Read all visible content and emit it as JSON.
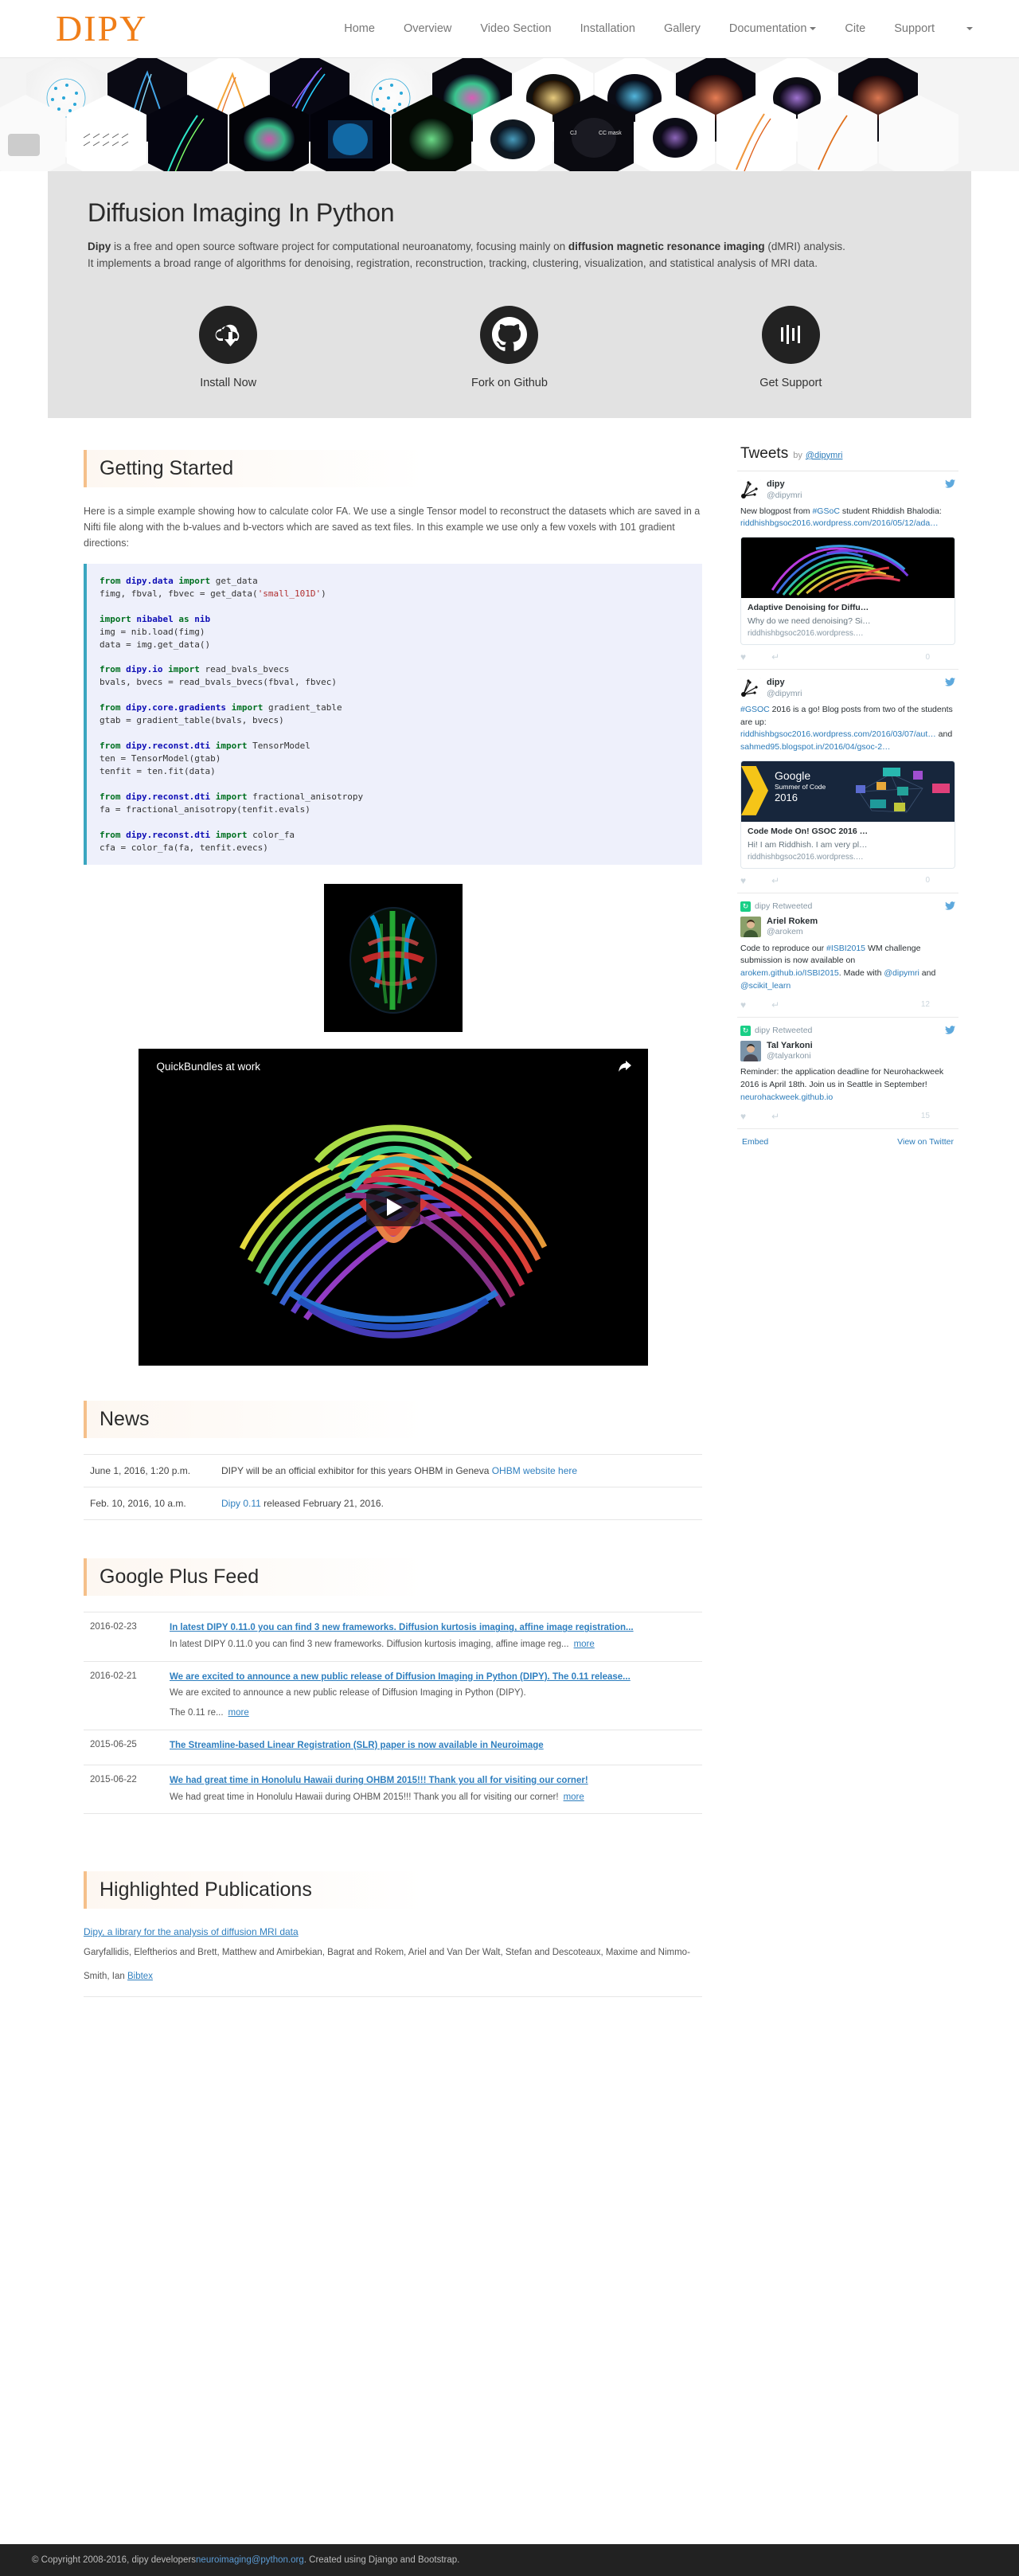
{
  "navbar": {
    "brand": "DIPY",
    "links": [
      {
        "label": "Home"
      },
      {
        "label": "Overview"
      },
      {
        "label": "Video Section"
      },
      {
        "label": "Installation"
      },
      {
        "label": "Gallery"
      },
      {
        "label": "Documentation",
        "caret": true
      },
      {
        "label": "Cite"
      },
      {
        "label": "Support"
      }
    ]
  },
  "jumbotron": {
    "title": "Diffusion Imaging In Python",
    "lead_1_bold": "Dipy",
    "lead_1": " is a free and open source software project for computational neuroanatomy, focusing mainly on ",
    "lead_2_bold": "diffusion magnetic resonance imaging",
    "lead_2": " (dMRI) analysis. It implements a broad range of algorithms for denoising, registration, reconstruction, tracking, clustering, visualization, and statistical analysis of MRI data."
  },
  "actions": [
    {
      "label": "Install Now",
      "icon": "cloud-download-icon"
    },
    {
      "label": "Fork on Github",
      "icon": "github-icon"
    },
    {
      "label": "Get Support",
      "icon": "bars-icon"
    }
  ],
  "getting_started": {
    "title": "Getting Started",
    "intro": "Here is a simple example showing how to calculate color FA. We use a single Tensor model to reconstruct the datasets which are saved in a Nifti file along with the b-values and b-vectors which are saved as text files. In this example we use only a few voxels with 101 gradient directions:",
    "code_lines": [
      [
        {
          "t": "from ",
          "c": "k"
        },
        {
          "t": "dipy.data",
          "c": "n"
        },
        {
          "t": " import ",
          "c": "k"
        },
        {
          "t": "get_data",
          "c": "p"
        }
      ],
      [
        {
          "t": "fimg, fbval, fbvec = get_data(",
          "c": "p"
        },
        {
          "t": "'small_101D'",
          "c": "s"
        },
        {
          "t": ")",
          "c": "p"
        }
      ],
      [],
      [
        {
          "t": "import ",
          "c": "k"
        },
        {
          "t": "nibabel",
          "c": "n"
        },
        {
          "t": " as ",
          "c": "k"
        },
        {
          "t": "nib",
          "c": "n"
        }
      ],
      [
        {
          "t": "img = nib.load(fimg)",
          "c": "p"
        }
      ],
      [
        {
          "t": "data = img.get_data()",
          "c": "p"
        }
      ],
      [],
      [
        {
          "t": "from ",
          "c": "k"
        },
        {
          "t": "dipy.io",
          "c": "n"
        },
        {
          "t": " import ",
          "c": "k"
        },
        {
          "t": "read_bvals_bvecs",
          "c": "p"
        }
      ],
      [
        {
          "t": "bvals, bvecs = read_bvals_bvecs(fbval, fbvec)",
          "c": "p"
        }
      ],
      [],
      [
        {
          "t": "from ",
          "c": "k"
        },
        {
          "t": "dipy.core.gradients",
          "c": "n"
        },
        {
          "t": " import ",
          "c": "k"
        },
        {
          "t": "gradient_table",
          "c": "p"
        }
      ],
      [
        {
          "t": "gtab = gradient_table(bvals, bvecs)",
          "c": "p"
        }
      ],
      [],
      [
        {
          "t": "from ",
          "c": "k"
        },
        {
          "t": "dipy.reconst.dti",
          "c": "n"
        },
        {
          "t": " import ",
          "c": "k"
        },
        {
          "t": "TensorModel",
          "c": "p"
        }
      ],
      [
        {
          "t": "ten = TensorModel(gtab)",
          "c": "p"
        }
      ],
      [
        {
          "t": "tenfit = ten.fit(data)",
          "c": "p"
        }
      ],
      [],
      [
        {
          "t": "from ",
          "c": "k"
        },
        {
          "t": "dipy.reconst.dti",
          "c": "n"
        },
        {
          "t": " import ",
          "c": "k"
        },
        {
          "t": "fractional_anisotropy",
          "c": "p"
        }
      ],
      [
        {
          "t": "fa = fractional_anisotropy(tenfit.evals)",
          "c": "p"
        }
      ],
      [],
      [
        {
          "t": "from ",
          "c": "k"
        },
        {
          "t": "dipy.reconst.dti",
          "c": "n"
        },
        {
          "t": " import ",
          "c": "k"
        },
        {
          "t": "color_fa",
          "c": "p"
        }
      ],
      [
        {
          "t": "cfa = color_fa(fa, tenfit.evecs)",
          "c": "p"
        }
      ]
    ]
  },
  "video": {
    "title": "QuickBundles at work",
    "share_icon": "share-icon",
    "play_icon": "play-icon"
  },
  "news": {
    "title": "News",
    "rows": [
      {
        "date": "June 1, 2016, 1:20 p.m.",
        "text": "DIPY will be an official exhibitor for this years OHBM in Geneva ",
        "link": "OHBM website here",
        "link_after": ""
      },
      {
        "date": "Feb. 10, 2016, 10 a.m.",
        "link_first": "Dipy 0.11",
        "text": " released February 21, 2016."
      }
    ]
  },
  "gplus": {
    "title": "Google Plus Feed",
    "rows": [
      {
        "date": "2016-02-23",
        "title": "In latest DIPY 0.11.0 you can find 3 new frameworks. Diffusion kurtosis imaging, affine image registration...",
        "body": "In latest DIPY 0.11.0 you can find 3 new frameworks. Diffusion kurtosis imaging, affine image reg...",
        "more": "more"
      },
      {
        "date": "2016-02-21",
        "title": "We are excited to announce a new public release of Diffusion Imaging in Python (DIPY). The 0.11 release...",
        "body": "We are excited to announce a new public release of Diffusion Imaging in Python (DIPY).",
        "body2": "The 0.11 re...",
        "more": "more"
      },
      {
        "date": "2015-06-25",
        "title": "The Streamline-based Linear Registration (SLR) paper is now available in Neuroimage",
        "body": "",
        "more": ""
      },
      {
        "date": "2015-06-22",
        "title": "We had great time in Honolulu Hawaii during OHBM 2015!!! Thank you all for visiting our corner!",
        "body": "We had great time in Honolulu Hawaii during OHBM 2015!!! Thank you all for visiting our corner!",
        "more": "more"
      }
    ]
  },
  "publications": {
    "title": "Highlighted Publications",
    "items": [
      {
        "title": "Dipy, a library for the analysis of diffusion MRI data",
        "authors": "Garyfallidis, Eleftherios and Brett, Matthew and Amirbekian, Bagrat and Rokem, Ariel and Van Der Walt, Stefan and Descoteaux, Maxime and Nimmo-Smith, Ian",
        "bibtex": "Bibtex"
      }
    ]
  },
  "twitter": {
    "heading": "Tweets",
    "by": "by",
    "handle": "@dipymri",
    "footer": {
      "embed": "Embed",
      "view": "View on Twitter"
    },
    "tweets": [
      {
        "retweet": null,
        "name": "dipy",
        "handle": "@dipymri",
        "avatar": "dipy-logo-avatar",
        "text_parts": [
          {
            "t": "New blogpost from ",
            "link": false
          },
          {
            "t": "#GSoC",
            "link": true
          },
          {
            "t": " student Rhiddish Bhalodia: ",
            "link": false
          },
          {
            "t": "riddhishbgsoc2016.wordpress.com/2016/05/12/ada…",
            "link": true
          }
        ],
        "card": {
          "img": "tractography-thumb",
          "title": "Adaptive Denoising for Diffu…",
          "desc": "Why do we need denoising? Si…",
          "url": "riddhishbgsoc2016.wordpress.…"
        },
        "count": "0"
      },
      {
        "retweet": null,
        "name": "dipy",
        "handle": "@dipymri",
        "avatar": "dipy-logo-avatar",
        "text_parts": [
          {
            "t": "#GSOC",
            "link": true
          },
          {
            "t": " 2016 is a go! Blog posts from two of the students are up: ",
            "link": false
          },
          {
            "t": "riddhishbgsoc2016.wordpress.com/2016/03/07/aut…",
            "link": true
          },
          {
            "t": " and ",
            "link": false
          },
          {
            "t": "sahmed95.blogspot.in/2016/04/gsoc-2…",
            "link": true
          }
        ],
        "card": {
          "img": "gsoc-banner",
          "title": "Code Mode On! GSOC 2016 …",
          "desc": "Hi! I am Riddhish. I am very pl…",
          "url": "riddhishbgsoc2016.wordpress.…"
        },
        "count": "0"
      },
      {
        "retweet": "dipy Retweeted",
        "name": "Ariel Rokem",
        "handle": "@arokem",
        "avatar": "ariel-rokem-avatar",
        "text_parts": [
          {
            "t": "Code to reproduce our ",
            "link": false
          },
          {
            "t": "#ISBI2015",
            "link": true
          },
          {
            "t": " WM challenge submission is now available on ",
            "link": false
          },
          {
            "t": "arokem.github.io/ISBI2015",
            "link": true
          },
          {
            "t": ". Made with ",
            "link": false
          },
          {
            "t": "@dipymri",
            "link": true
          },
          {
            "t": " and ",
            "link": false
          },
          {
            "t": "@scikit_learn",
            "link": true
          }
        ],
        "card": null,
        "count": "12"
      },
      {
        "retweet": "dipy Retweeted",
        "name": "Tal Yarkoni",
        "handle": "@talyarkoni",
        "avatar": "tal-yarkoni-avatar",
        "text_parts": [
          {
            "t": "Reminder: the application deadline for Neurohackweek 2016 is April 18th. Join us in Seattle in September! ",
            "link": false
          },
          {
            "t": "neurohackweek.github.io",
            "link": true
          }
        ],
        "card": null,
        "count": "15"
      }
    ]
  },
  "footer": {
    "copyright_before": "© Copyright 2008-2016, dipy developers ",
    "email": "neuroimaging@python.org",
    "copyright_after": ". Created using Django and Bootstrap."
  },
  "colors": {
    "brand": "#f07e18",
    "link": "#2f7fbf",
    "code_bg": "#eef0fb",
    "code_border": "#3aa6c0",
    "jumbo_bg": "#e2e2e2",
    "footer_bg": "#222222"
  }
}
